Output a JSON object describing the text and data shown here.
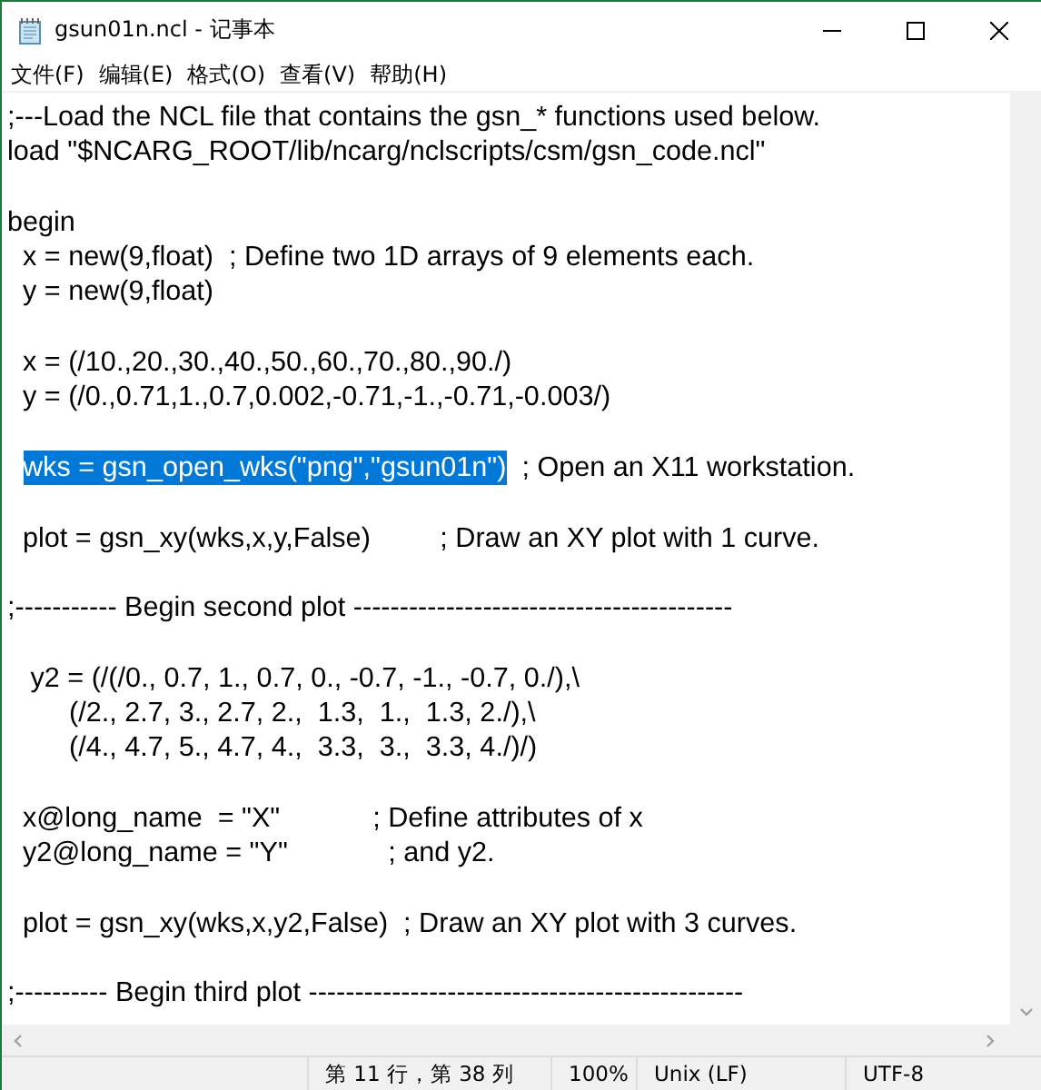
{
  "window": {
    "title": "gsun01n.ncl - 记事本"
  },
  "menu": [
    "文件(F)",
    "编辑(E)",
    "格式(O)",
    "查看(V)",
    "帮助(H)"
  ],
  "editor": {
    "blocks": [
      [
        ";---Load the NCL file that contains the gsn_* functions used below.",
        "load \"$NCARG_ROOT/lib/ncarg/nclscripts/csm/gsn_code.ncl\""
      ],
      [
        "begin",
        "  x = new(9,float)  ; Define two 1D arrays of 9 elements each.",
        "  y = new(9,float)"
      ],
      [
        "  x = (/10.,20.,30.,40.,50.,60.,70.,80.,90./)",
        "  y = (/0.,0.71,1.,0.7,0.002,-0.71,-1.,-0.71,-0.003/)"
      ],
      [
        {
          "selected_text": "wks = gsn_open_wks(\"png\",\"gsun01n\")",
          "rest": "  ; Open an X11 workstation."
        }
      ],
      [
        "  plot = gsn_xy(wks,x,y,False)         ; Draw an XY plot with 1 curve."
      ],
      [
        ";----------- Begin second plot -----------------------------------------"
      ],
      [
        "   y2 = (/(/0., 0.7, 1., 0.7, 0., -0.7, -1., -0.7, 0./),\\",
        "        (/2., 2.7, 3., 2.7, 2.,  1.3,  1.,  1.3, 2./),\\",
        "        (/4., 4.7, 5., 4.7, 4.,  3.3,  3.,  3.3, 4./)/)"
      ],
      [
        "  x@long_name  = \"X\"            ; Define attributes of x",
        "  y2@long_name = \"Y\"             ; and y2."
      ],
      [
        "  plot = gsn_xy(wks,x,y2,False)  ; Draw an XY plot with 3 curves."
      ],
      [
        ";---------- Begin third plot -----------------------------------------------"
      ]
    ]
  },
  "status_bar": [
    "第 11 行，第 38 列",
    "100%",
    "Unix (LF)",
    "UTF-8"
  ]
}
